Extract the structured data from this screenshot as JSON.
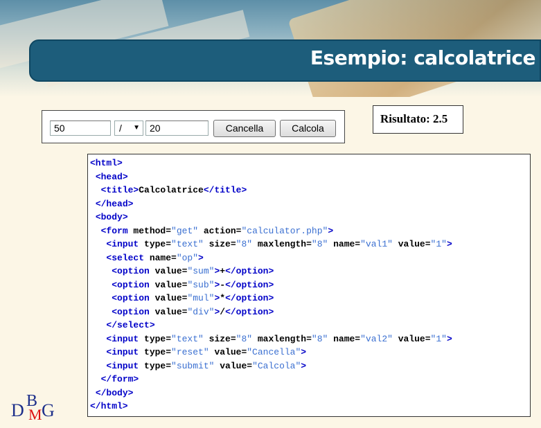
{
  "slide": {
    "title": "Esempio: calcolatrice"
  },
  "demo_form": {
    "val1": "50",
    "operator": "/",
    "val2": "20",
    "reset_label": "Cancella",
    "submit_label": "Calcola"
  },
  "result": {
    "text": "Risultato: 2.5"
  },
  "code": {
    "lines": [
      {
        "indent": "",
        "parts": [
          [
            "tag",
            "<html>"
          ]
        ]
      },
      {
        "indent": " ",
        "parts": [
          [
            "tag",
            "<head>"
          ]
        ]
      },
      {
        "indent": "  ",
        "parts": [
          [
            "tag",
            "<title>"
          ],
          [
            "txt",
            "Calcolatrice"
          ],
          [
            "tag",
            "</title>"
          ]
        ]
      },
      {
        "indent": " ",
        "parts": [
          [
            "tag",
            "</head>"
          ]
        ]
      },
      {
        "indent": " ",
        "parts": [
          [
            "tag",
            "<body>"
          ]
        ]
      },
      {
        "indent": "  ",
        "parts": [
          [
            "tag",
            "<form"
          ],
          [
            "txt",
            " method="
          ],
          [
            "str",
            "\"get\""
          ],
          [
            "txt",
            " action="
          ],
          [
            "str",
            "\"calculator.php\""
          ],
          [
            "tag",
            ">"
          ]
        ]
      },
      {
        "indent": "   ",
        "parts": [
          [
            "tag",
            "<input"
          ],
          [
            "txt",
            " type="
          ],
          [
            "str",
            "\"text\""
          ],
          [
            "txt",
            " size="
          ],
          [
            "str",
            "\"8\""
          ],
          [
            "txt",
            " maxlength="
          ],
          [
            "str",
            "\"8\""
          ],
          [
            "txt",
            " name="
          ],
          [
            "str",
            "\"val1\""
          ],
          [
            "txt",
            " value="
          ],
          [
            "str",
            "\"1\""
          ],
          [
            "tag",
            ">"
          ]
        ]
      },
      {
        "indent": "   ",
        "parts": [
          [
            "tag",
            "<select"
          ],
          [
            "txt",
            " name="
          ],
          [
            "str",
            "\"op\""
          ],
          [
            "tag",
            ">"
          ]
        ]
      },
      {
        "indent": "    ",
        "parts": [
          [
            "tag",
            "<option"
          ],
          [
            "txt",
            " value="
          ],
          [
            "str",
            "\"sum\""
          ],
          [
            "tag",
            ">"
          ],
          [
            "txt",
            "+"
          ],
          [
            "tag",
            "</option>"
          ]
        ]
      },
      {
        "indent": "    ",
        "parts": [
          [
            "tag",
            "<option"
          ],
          [
            "txt",
            " value="
          ],
          [
            "str",
            "\"sub\""
          ],
          [
            "tag",
            ">"
          ],
          [
            "txt",
            "-"
          ],
          [
            "tag",
            "</option>"
          ]
        ]
      },
      {
        "indent": "    ",
        "parts": [
          [
            "tag",
            "<option"
          ],
          [
            "txt",
            " value="
          ],
          [
            "str",
            "\"mul\""
          ],
          [
            "tag",
            ">"
          ],
          [
            "txt",
            "*"
          ],
          [
            "tag",
            "</option>"
          ]
        ]
      },
      {
        "indent": "    ",
        "parts": [
          [
            "tag",
            "<option"
          ],
          [
            "txt",
            " value="
          ],
          [
            "str",
            "\"div\""
          ],
          [
            "tag",
            ">"
          ],
          [
            "txt",
            "/"
          ],
          [
            "tag",
            "</option>"
          ]
        ]
      },
      {
        "indent": "   ",
        "parts": [
          [
            "tag",
            "</select>"
          ]
        ]
      },
      {
        "indent": "   ",
        "parts": [
          [
            "tag",
            "<input"
          ],
          [
            "txt",
            " type="
          ],
          [
            "str",
            "\"text\""
          ],
          [
            "txt",
            " size="
          ],
          [
            "str",
            "\"8\""
          ],
          [
            "txt",
            " maxlength="
          ],
          [
            "str",
            "\"8\""
          ],
          [
            "txt",
            " name="
          ],
          [
            "str",
            "\"val2\""
          ],
          [
            "txt",
            " value="
          ],
          [
            "str",
            "\"1\""
          ],
          [
            "tag",
            ">"
          ]
        ]
      },
      {
        "indent": "   ",
        "parts": [
          [
            "tag",
            "<input"
          ],
          [
            "txt",
            " type="
          ],
          [
            "str",
            "\"reset\""
          ],
          [
            "txt",
            " value="
          ],
          [
            "str",
            "\"Cancella\""
          ],
          [
            "tag",
            ">"
          ]
        ]
      },
      {
        "indent": "   ",
        "parts": [
          [
            "tag",
            "<input"
          ],
          [
            "txt",
            " type="
          ],
          [
            "str",
            "\"submit\""
          ],
          [
            "txt",
            " value="
          ],
          [
            "str",
            "\"Calcola\""
          ],
          [
            "tag",
            ">"
          ]
        ]
      },
      {
        "indent": "  ",
        "parts": [
          [
            "tag",
            "</form>"
          ]
        ]
      },
      {
        "indent": " ",
        "parts": [
          [
            "tag",
            "</body>"
          ]
        ]
      },
      {
        "indent": "",
        "parts": [
          [
            "tag",
            "</html>"
          ]
        ]
      }
    ]
  },
  "logo": {
    "d": "D",
    "b": "B",
    "m": "M",
    "g": "G"
  }
}
